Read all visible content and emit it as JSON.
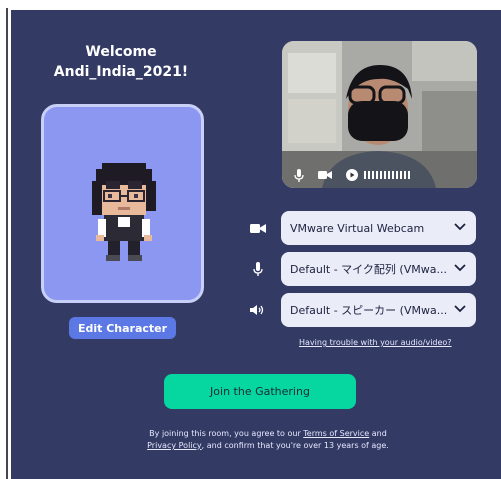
{
  "welcome": {
    "line1": "Welcome",
    "line2": "Andi_India_2021!"
  },
  "avatar": {
    "edit_label": "Edit Character"
  },
  "video": {
    "mic_icon": "microphone-icon",
    "cam_icon": "camera-icon",
    "play_icon": "play-icon"
  },
  "devices": {
    "camera": "VMware Virtual Webcam",
    "microphone": "Default - マイク配列 (VMwa...",
    "speaker": "Default - スピーカー (VMwa..."
  },
  "trouble_link": "Having trouble with your audio/video?",
  "join_label": "Join the Gathering",
  "legal": {
    "part1": "By joining this room, you agree to our",
    "terms": "Terms of Service",
    "and": "and",
    "privacy": "Privacy Policy",
    "part2": ", and confirm that you're over 13 years of age."
  },
  "colors": {
    "panel_bg": "#333a64",
    "accent_join": "#06d6a0",
    "edit_button": "#5b78e4",
    "avatar_bg": "#8b97f1"
  }
}
